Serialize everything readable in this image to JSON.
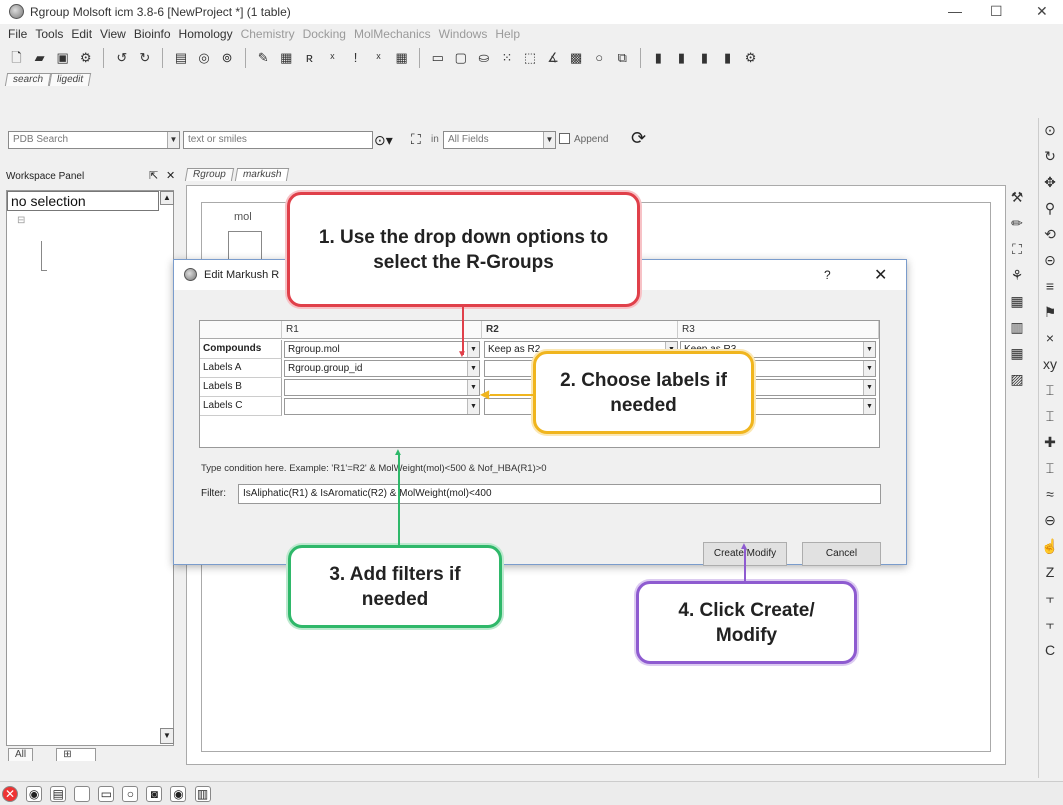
{
  "window": {
    "title": "Rgroup Molsoft icm 3.8-6  [NewProject *] (1 table)"
  },
  "menu": {
    "items": [
      {
        "label": "File",
        "enabled": true
      },
      {
        "label": "Tools",
        "enabled": true
      },
      {
        "label": "Edit",
        "enabled": true
      },
      {
        "label": "View",
        "enabled": true
      },
      {
        "label": "Bioinfo",
        "enabled": true
      },
      {
        "label": "Homology",
        "enabled": true
      },
      {
        "label": "Chemistry",
        "enabled": false
      },
      {
        "label": "Docking",
        "enabled": false
      },
      {
        "label": "MolMechanics",
        "enabled": false
      },
      {
        "label": "Windows",
        "enabled": false
      },
      {
        "label": "Help",
        "enabled": false
      }
    ]
  },
  "top_tabs": [
    "search",
    "ligedit"
  ],
  "search": {
    "source": "PDB Search",
    "query_placeholder": "text or smiles",
    "in_label": "in",
    "field": "All Fields",
    "append_label": "Append"
  },
  "workspace": {
    "title": "Workspace Panel",
    "selection": "no selection"
  },
  "bottom_tabs": [
    "All"
  ],
  "doc_tabs": [
    "Rgroup",
    "markush"
  ],
  "grid": {
    "column": "mol"
  },
  "dialog": {
    "title": "Edit Markush R",
    "help": "?",
    "columns": [
      "R1",
      "R2",
      "R3"
    ],
    "rows": [
      {
        "label": "Compounds",
        "values": [
          "Rgroup.mol",
          "Keep as R2",
          "Keep as R3"
        ]
      },
      {
        "label": "Labels A",
        "values": [
          "Rgroup.group_id",
          "",
          ""
        ]
      },
      {
        "label": "Labels B",
        "values": [
          "",
          "",
          ""
        ]
      },
      {
        "label": "Labels C",
        "values": [
          "",
          "",
          ""
        ]
      }
    ],
    "hint": "Type condition here. Example: 'R1'=R2' & MolWeight(mol)<500 & Nof_HBA(R1)>0",
    "filter_label": "Filter:",
    "filter_value": "IsAliphatic(R1) & IsAromatic(R2) & MolWeight(mol)<400",
    "create_button": "Create/Modify",
    "cancel_button": "Cancel"
  },
  "callouts": {
    "c1": "1. Use the drop down options to select the R-Groups",
    "c2": "2. Choose labels if needed",
    "c3": "3. Add filters if needed",
    "c4": "4. Click Create/ Modify"
  },
  "colors": {
    "c1": "#e0404a",
    "c2": "#f0b51e",
    "c3": "#2fb86a",
    "c4": "#8e5bd0"
  }
}
